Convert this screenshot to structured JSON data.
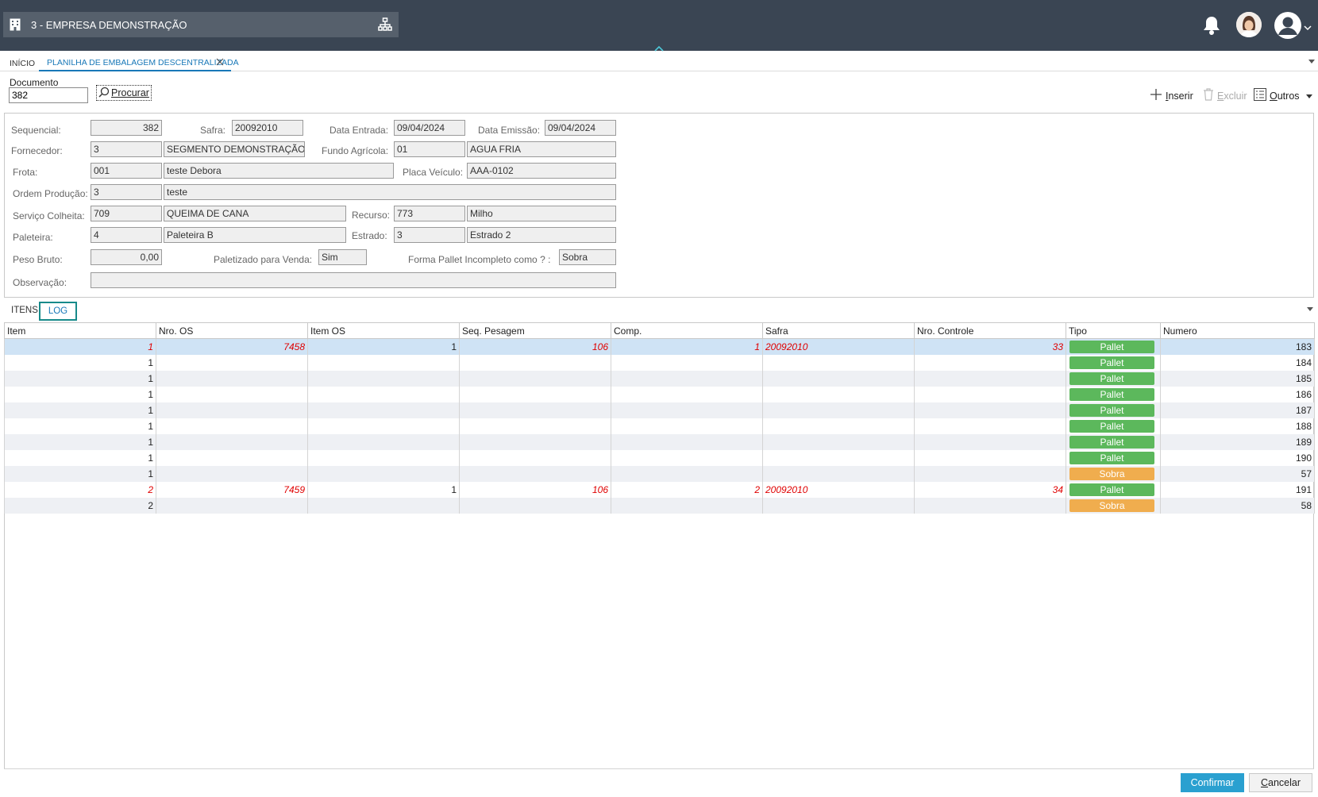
{
  "header": {
    "company": "3 - EMPRESA DEMONSTRAÇÃO"
  },
  "tabs": [
    {
      "label": "INÍCIO"
    },
    {
      "label": "PLANILHA DE EMBALAGEM DESCENTRALIZADA"
    }
  ],
  "document": {
    "label": "Documento",
    "value": "382",
    "search_label": "Procurar"
  },
  "toolbar": {
    "insert": "Inserir",
    "delete": "Excluir",
    "others": "Outros"
  },
  "form": {
    "sequencial": {
      "label": "Sequencial:",
      "value": "382"
    },
    "safra": {
      "label": "Safra:",
      "value": "20092010"
    },
    "data_entrada": {
      "label": "Data Entrada:",
      "value": "09/04/2024"
    },
    "data_emissao": {
      "label": "Data Emissão:",
      "value": "09/04/2024"
    },
    "fornecedor": {
      "label": "Fornecedor:",
      "code": "3",
      "name": "SEGMENTO DEMONSTRAÇÃO"
    },
    "fundo_agricola": {
      "label": "Fundo Agrícola:",
      "code": "01",
      "name": "AGUA FRIA"
    },
    "frota": {
      "label": "Frota:",
      "code": "001",
      "name": "teste Debora"
    },
    "placa_veiculo": {
      "label": "Placa Veículo:",
      "value": "AAA-0102"
    },
    "ordem_producao": {
      "label": "Ordem Produção:",
      "code": "3",
      "name": "teste"
    },
    "servico_colheita": {
      "label": "Serviço Colheita:",
      "code": "709",
      "name": "QUEIMA DE CANA"
    },
    "recurso": {
      "label": "Recurso:",
      "code": "773",
      "name": "Milho"
    },
    "paleteira": {
      "label": "Paleteira:",
      "code": "4",
      "name": "Paleteira B"
    },
    "estrado": {
      "label": "Estrado:",
      "code": "3",
      "name": "Estrado 2"
    },
    "peso_bruto": {
      "label": "Peso Bruto:",
      "value": "0,00"
    },
    "paletizado": {
      "label": "Paletizado para Venda:",
      "value": "Sim"
    },
    "forma_pallet": {
      "label": "Forma Pallet Incompleto como ? :",
      "value": "Sobra"
    },
    "observacao": {
      "label": "Observação:",
      "value": ""
    }
  },
  "subtabs": {
    "itens": "ITENS",
    "log": "LOG"
  },
  "grid": {
    "columns": [
      "Item",
      "Nro. OS",
      "Item OS",
      "Seq. Pesagem",
      "Comp.",
      "Safra",
      "Nro. Controle",
      "Tipo",
      "Numero"
    ],
    "rows": [
      {
        "item": "1",
        "nro_os": "7458",
        "item_os": "1",
        "seq": "106",
        "comp": "1",
        "safra": "20092010",
        "controle": "33",
        "tipo": "Pallet",
        "numero": "183"
      },
      {
        "item": "1",
        "nro_os": "",
        "item_os": "",
        "seq": "",
        "comp": "",
        "safra": "",
        "controle": "",
        "tipo": "Pallet",
        "numero": "184"
      },
      {
        "item": "1",
        "nro_os": "",
        "item_os": "",
        "seq": "",
        "comp": "",
        "safra": "",
        "controle": "",
        "tipo": "Pallet",
        "numero": "185"
      },
      {
        "item": "1",
        "nro_os": "",
        "item_os": "",
        "seq": "",
        "comp": "",
        "safra": "",
        "controle": "",
        "tipo": "Pallet",
        "numero": "186"
      },
      {
        "item": "1",
        "nro_os": "",
        "item_os": "",
        "seq": "",
        "comp": "",
        "safra": "",
        "controle": "",
        "tipo": "Pallet",
        "numero": "187"
      },
      {
        "item": "1",
        "nro_os": "",
        "item_os": "",
        "seq": "",
        "comp": "",
        "safra": "",
        "controle": "",
        "tipo": "Pallet",
        "numero": "188"
      },
      {
        "item": "1",
        "nro_os": "",
        "item_os": "",
        "seq": "",
        "comp": "",
        "safra": "",
        "controle": "",
        "tipo": "Pallet",
        "numero": "189"
      },
      {
        "item": "1",
        "nro_os": "",
        "item_os": "",
        "seq": "",
        "comp": "",
        "safra": "",
        "controle": "",
        "tipo": "Pallet",
        "numero": "190"
      },
      {
        "item": "1",
        "nro_os": "",
        "item_os": "",
        "seq": "",
        "comp": "",
        "safra": "",
        "controle": "",
        "tipo": "Sobra",
        "numero": "57"
      },
      {
        "item": "2",
        "nro_os": "7459",
        "item_os": "1",
        "seq": "106",
        "comp": "2",
        "safra": "20092010",
        "controle": "34",
        "tipo": "Pallet",
        "numero": "191"
      },
      {
        "item": "2",
        "nro_os": "",
        "item_os": "",
        "seq": "",
        "comp": "",
        "safra": "",
        "controle": "",
        "tipo": "Sobra",
        "numero": "58"
      }
    ]
  },
  "footer": {
    "confirm": "Confirmar",
    "cancel": "Cancelar"
  },
  "colors": {
    "topbar": "#3a4553",
    "accent": "#1878b8",
    "pallet": "#5cb85c",
    "sobra": "#f0ad4e",
    "confirm": "#2aa0d0"
  }
}
